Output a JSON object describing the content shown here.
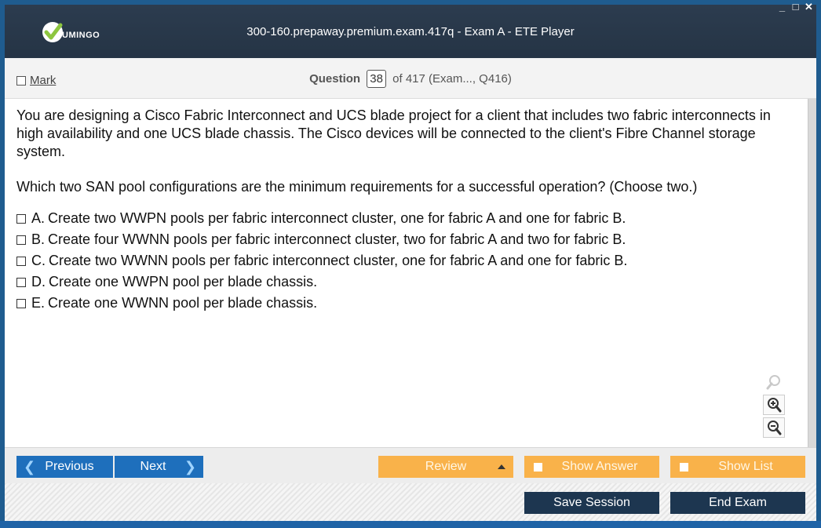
{
  "titlebar": {
    "logo_text": "UMINGO",
    "title": "300-160.prepaway.premium.exam.417q - Exam A - ETE Player",
    "controls": [
      "_",
      "□",
      "✕"
    ]
  },
  "header": {
    "mark_label": "Mark",
    "question_label": "Question",
    "question_number": "38",
    "question_of": "of 417 (Exam..., Q416)"
  },
  "question": {
    "text": "You are designing a Cisco Fabric Interconnect and UCS blade project for a client that includes two fabric interconnects in high availability and one UCS blade chassis. The Cisco devices will be connected to the client's Fibre Channel storage system.",
    "prompt": "Which two SAN pool configurations are the minimum requirements for a successful operation? (Choose two.)",
    "answers": [
      {
        "letter": "A.",
        "text": "Create two WWPN pools per fabric interconnect cluster, one for fabric A and one for fabric B."
      },
      {
        "letter": "B.",
        "text": "Create four WWNN pools per fabric interconnect cluster, two for fabric A and two for fabric B."
      },
      {
        "letter": "C.",
        "text": "Create two WWNN pools per fabric interconnect cluster, one for fabric A and one for fabric B."
      },
      {
        "letter": "D.",
        "text": "Create one WWPN pool per blade chassis."
      },
      {
        "letter": "E.",
        "text": "Create one WWNN pool per blade chassis."
      }
    ]
  },
  "zoom": {
    "icons": [
      "zoom-reset-icon",
      "zoom-in-icon",
      "zoom-out-icon"
    ]
  },
  "nav": {
    "previous": "Previous",
    "next": "Next",
    "review": "Review",
    "show_answer": "Show Answer",
    "show_list": "Show List"
  },
  "footer": {
    "save_session": "Save Session",
    "end_exam": "End Exam"
  },
  "colors": {
    "titlebar": "#2c3c4f",
    "blue_button": "#1e6fbc",
    "orange_button": "#f9b24a",
    "dark_button": "#1d3650",
    "logo_green": "#8dc63f"
  }
}
